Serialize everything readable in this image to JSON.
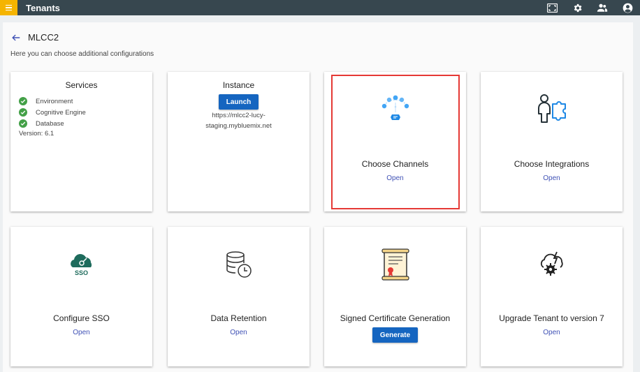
{
  "app": {
    "title": "Tenants"
  },
  "header": {
    "tenant_name": "MLCC2",
    "subtitle": "Here you can choose additional configurations"
  },
  "services": {
    "title": "Services",
    "items": [
      "Environment",
      "Cognitive Engine",
      "Database"
    ],
    "version": "Version: 6.1"
  },
  "instance": {
    "title": "Instance",
    "button_label": "Launch",
    "url_line1": "https://mlcc2-lucy-",
    "url_line2": "staging.mybluemix.net"
  },
  "channels": {
    "title": "Choose Channels",
    "link": "Open"
  },
  "integrations": {
    "title": "Choose Integrations",
    "link": "Open"
  },
  "sso": {
    "title": "Configure SSO",
    "link": "Open",
    "icon_text": "SSO"
  },
  "retention": {
    "title": "Data Retention",
    "link": "Open"
  },
  "certificate": {
    "title": "Signed Certificate Generation",
    "button_label": "Generate"
  },
  "upgrade": {
    "title": "Upgrade Tenant to version 7",
    "link": "Open"
  },
  "colors": {
    "topbar": "#37474f",
    "menu": "#f5b400",
    "primary": "#1565c0",
    "link": "#3f51b5",
    "check": "#43a047",
    "sso": "#1e6b5c",
    "highlight": "#e53935"
  }
}
